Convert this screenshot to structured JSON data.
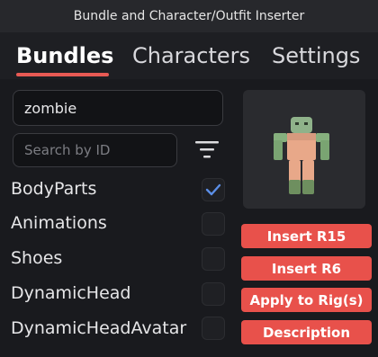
{
  "window": {
    "title": "Bundle and Character/Outfit Inserter"
  },
  "tabs": [
    {
      "label": "Bundles",
      "active": true
    },
    {
      "label": "Characters",
      "active": false
    },
    {
      "label": "Settings",
      "active": false
    }
  ],
  "search": {
    "value": "zombie"
  },
  "id_search": {
    "placeholder": "Search by ID"
  },
  "filters": [
    {
      "label": "BodyParts",
      "checked": true
    },
    {
      "label": "Animations",
      "checked": false
    },
    {
      "label": "Shoes",
      "checked": false
    },
    {
      "label": "DynamicHead",
      "checked": false
    },
    {
      "label": "DynamicHeadAvatar",
      "checked": false
    }
  ],
  "actions": {
    "insert_r15": "Insert R15",
    "insert_r6": "Insert R6",
    "apply_to_rig": "Apply to Rig(s)",
    "description": "Description"
  },
  "colors": {
    "accent": "#e8514b",
    "check": "#5b8ee6",
    "background": "#191a1e"
  }
}
